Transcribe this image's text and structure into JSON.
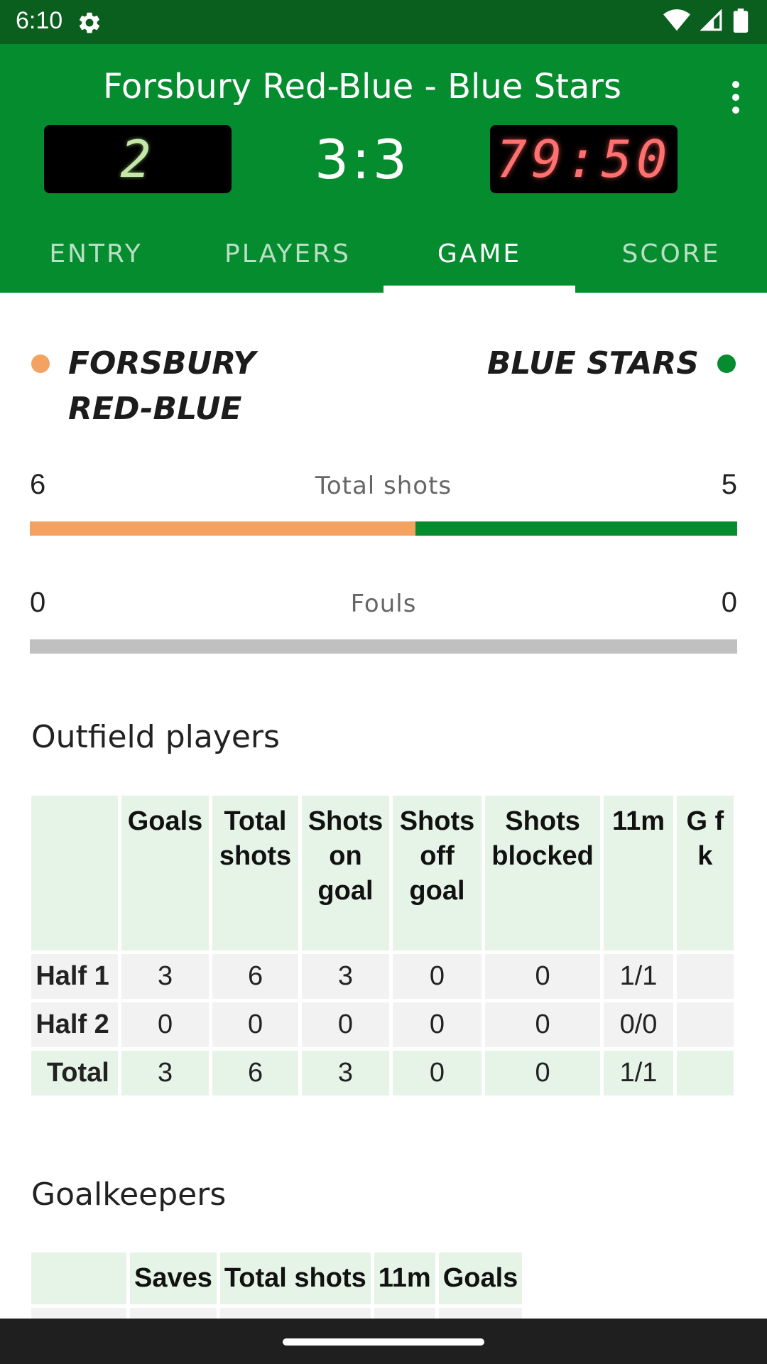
{
  "status_bar": {
    "time": "6:10"
  },
  "header": {
    "title": "Forsbury Red-Blue - Blue Stars",
    "period": "2",
    "score": "3:3",
    "clock": "79:50",
    "menu_icon": "more-vert-icon"
  },
  "tabs": [
    {
      "label": "ENTRY"
    },
    {
      "label": "PLAYERS"
    },
    {
      "label": "GAME"
    },
    {
      "label": "SCORE"
    }
  ],
  "active_tab": "GAME",
  "teams": {
    "home": {
      "line1": "FORSBURY",
      "line2": "RED-BLUE",
      "color": "#f4a261"
    },
    "away": {
      "name": "BLUE STARS",
      "color": "#058c2e"
    }
  },
  "stats": {
    "total_shots": {
      "label": "Total shots",
      "home": "6",
      "away": "5"
    },
    "fouls": {
      "label": "Fouls",
      "home": "0",
      "away": "0"
    }
  },
  "outfield": {
    "title": "Outfield players",
    "headers": [
      "Goals",
      "Total shots",
      "Shots on goal",
      "Shots off goal",
      "Shots blocked",
      "11m",
      "G f k"
    ],
    "rows": [
      {
        "label": "Half 1",
        "values": [
          "3",
          "6",
          "3",
          "0",
          "0",
          "1/1",
          ""
        ]
      },
      {
        "label": "Half 2",
        "values": [
          "0",
          "0",
          "0",
          "0",
          "0",
          "0/0",
          ""
        ]
      },
      {
        "label": "Total",
        "values": [
          "3",
          "6",
          "3",
          "0",
          "0",
          "1/1",
          ""
        ]
      }
    ]
  },
  "goalkeepers": {
    "title": "Goalkeepers",
    "headers": [
      "Saves",
      "Total shots",
      "11m",
      "Goals"
    ]
  }
}
